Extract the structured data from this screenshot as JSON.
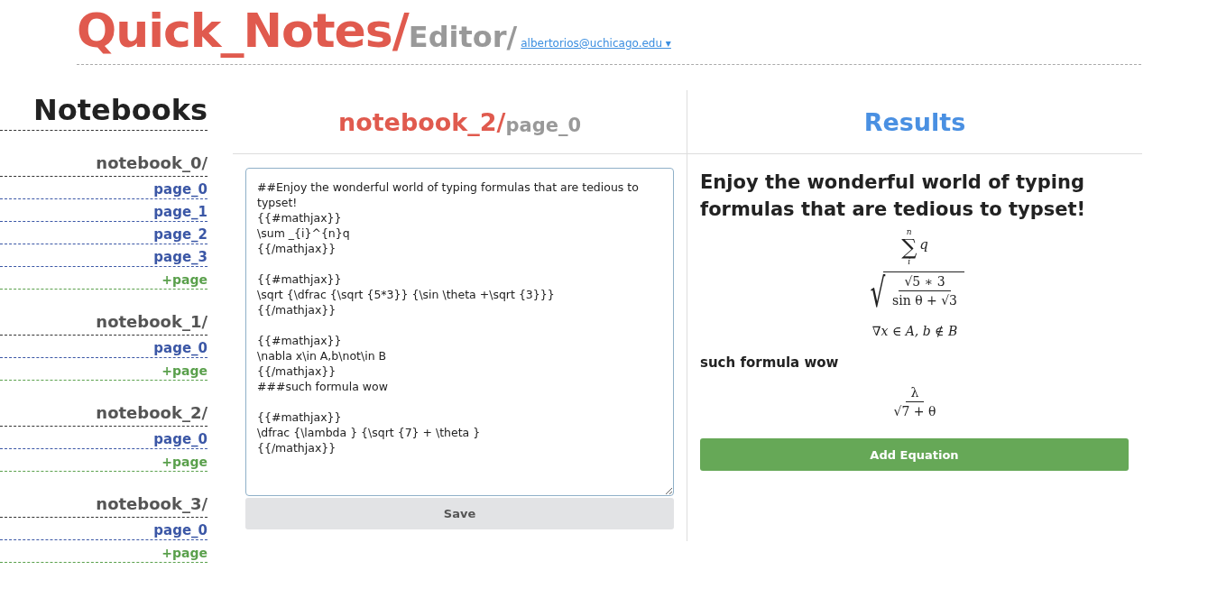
{
  "header": {
    "brand": "Quick_Notes/",
    "section": "Editor/",
    "user": "albertorios@uchicago.edu",
    "user_caret": "▾"
  },
  "sidebar": {
    "title": "Notebooks",
    "notebooks": [
      {
        "name": "notebook_0/",
        "pages": [
          "page_0",
          "page_1",
          "page_2",
          "page_3"
        ],
        "add": "+page"
      },
      {
        "name": "notebook_1/",
        "pages": [
          "page_0"
        ],
        "add": "+page"
      },
      {
        "name": "notebook_2/",
        "pages": [
          "page_0"
        ],
        "add": "+page"
      },
      {
        "name": "notebook_3/",
        "pages": [
          "page_0"
        ],
        "add": "+page"
      }
    ]
  },
  "editor": {
    "notebook": "notebook_2/",
    "page": "page_0",
    "value": "##Enjoy the wonderful world of typing formulas that are tedious to typset!\n{{#mathjax}}\n\\sum _{i}^{n}q\n{{/mathjax}}\n\n{{#mathjax}}\n\\sqrt {\\dfrac {\\sqrt {5*3}} {\\sin \\theta +\\sqrt {3}}}\n{{/mathjax}}\n\n{{#mathjax}}\n\\nabla x\\in A,b\\not\\in B\n{{/mathjax}}\n###such formula wow\n\n{{#mathjax}}\n\\dfrac {\\lambda } {\\sqrt {7} + \\theta }\n{{/mathjax}}",
    "save": "Save"
  },
  "results": {
    "title": "Results",
    "blocks": [
      {
        "kind": "heading",
        "text": "Enjoy the wonderful world of typing formulas that are tedious to typset!"
      },
      {
        "kind": "sum",
        "sign": "∑",
        "upper": "n",
        "lower": "i",
        "body": "q"
      },
      {
        "kind": "root_fraction",
        "radical": "√",
        "numerator": "√5 ∗ 3",
        "denominator": "sin θ + √3"
      },
      {
        "kind": "line",
        "text": "∇x ∈ A, b ∉ B"
      },
      {
        "kind": "subheading",
        "text": "such formula wow"
      },
      {
        "kind": "fraction",
        "numerator": "λ",
        "denominator": "√7 + θ"
      }
    ],
    "add": "Add Equation"
  }
}
